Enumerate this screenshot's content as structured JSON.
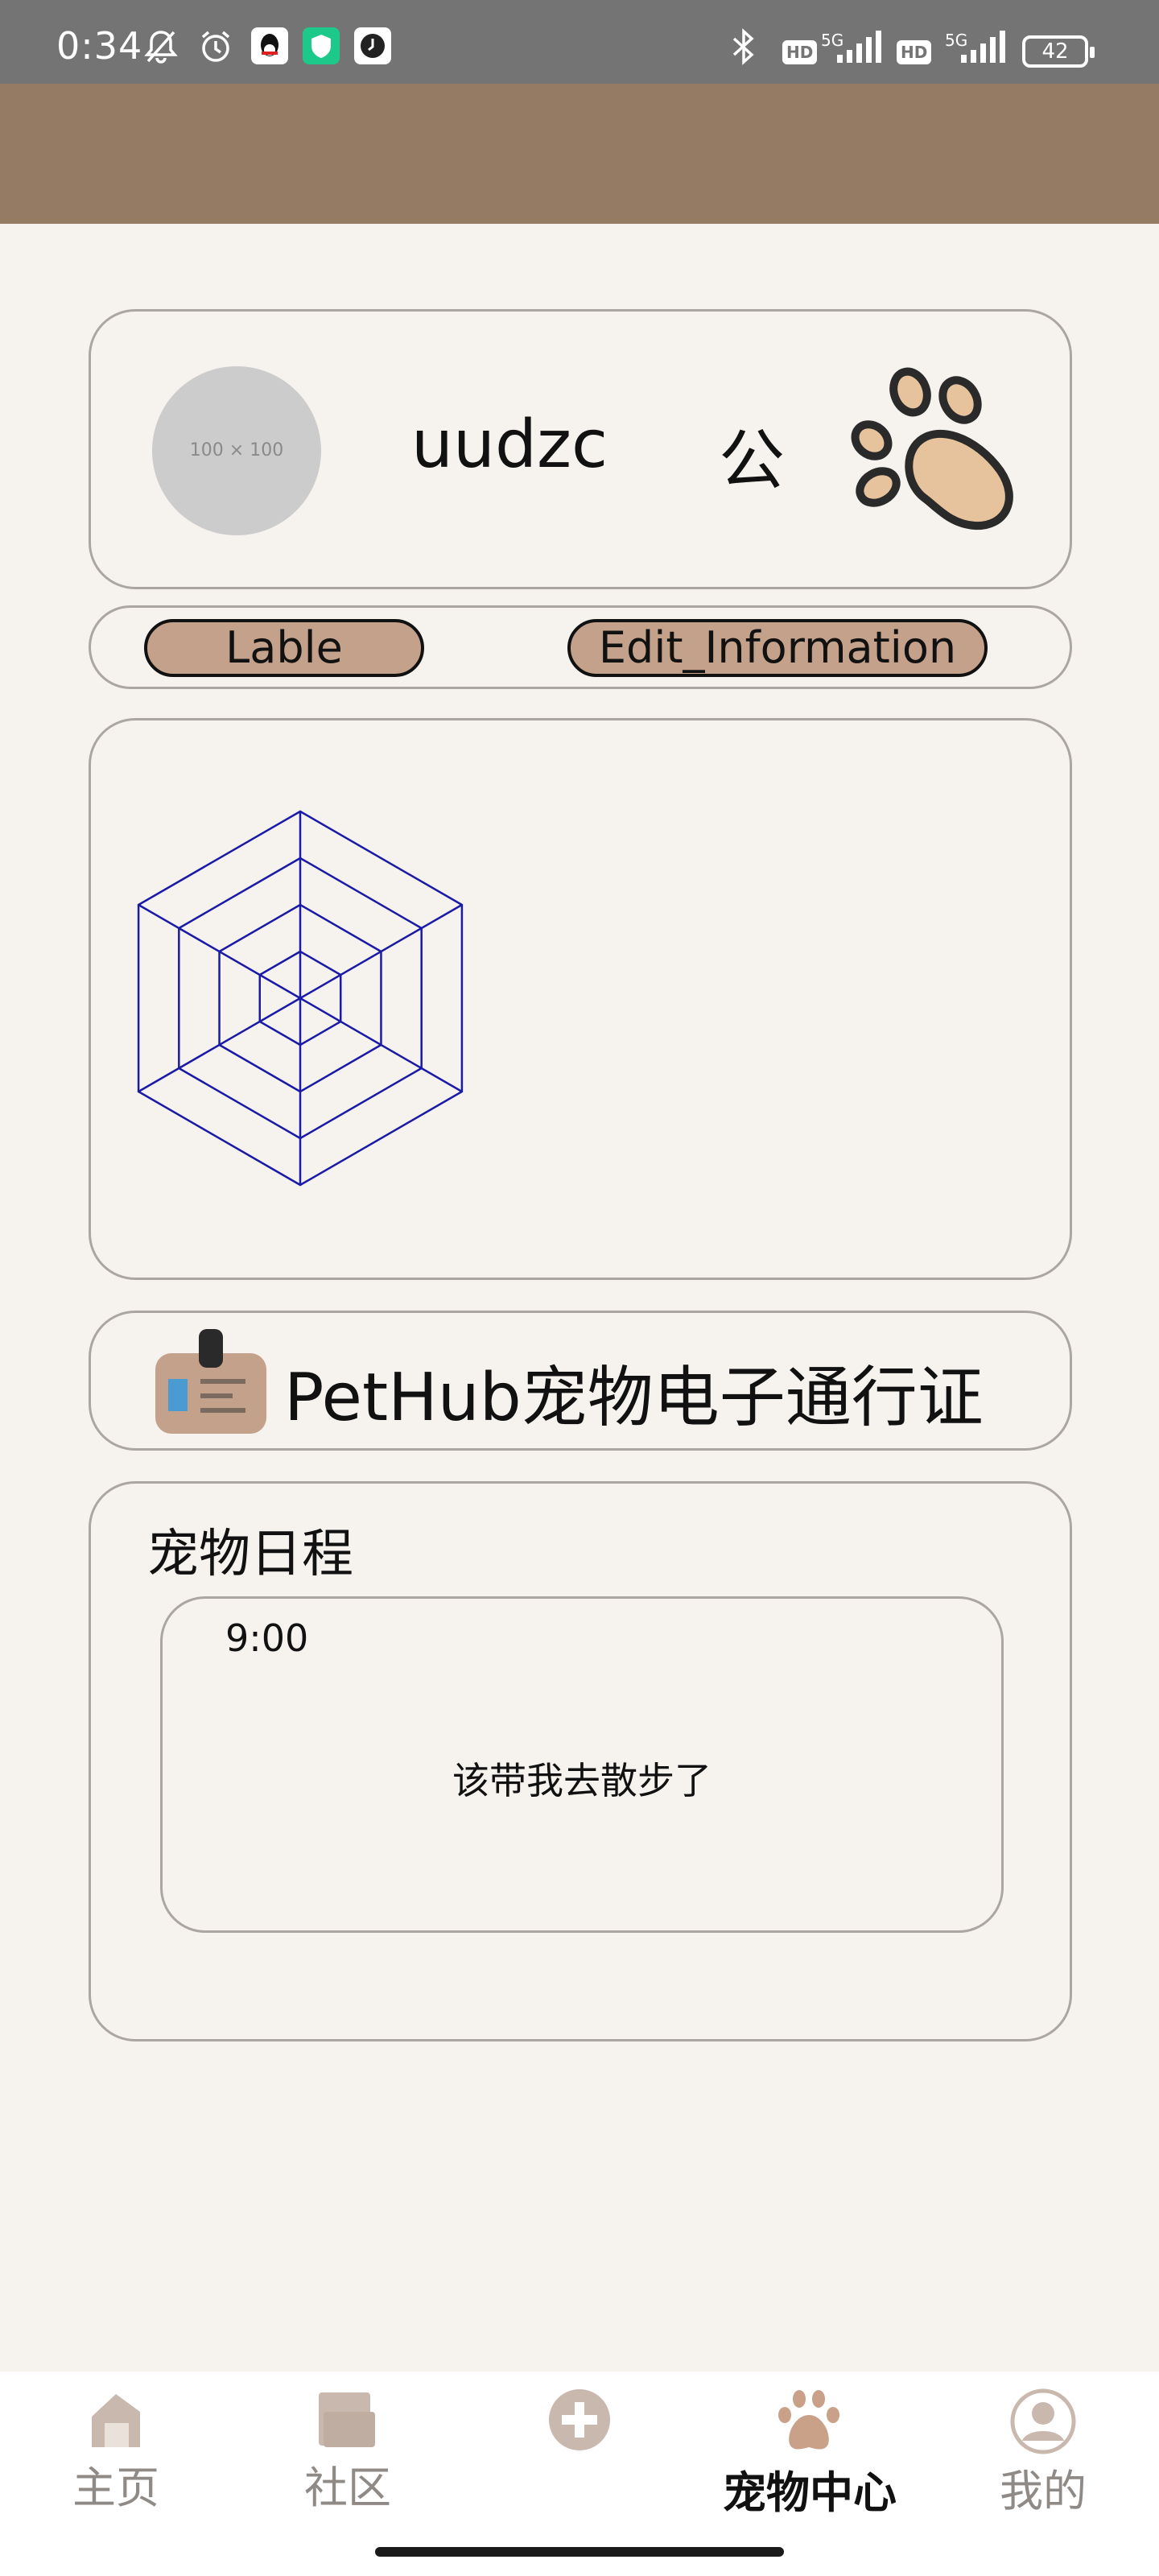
{
  "status_bar": {
    "time": "0:34",
    "battery": "42",
    "icons": [
      "mute-icon",
      "alarm-icon",
      "qq-icon",
      "security-app-icon",
      "clock-app-icon",
      "bluetooth-icon",
      "signal-icon"
    ],
    "network_badges": [
      "HD",
      "5G",
      "HD",
      "5G"
    ]
  },
  "profile": {
    "avatar_placeholder": "100 × 100",
    "name": "uudzc",
    "gender": "公",
    "logo_icon": "paw-icon"
  },
  "actions": {
    "label_button": "Lable",
    "edit_button": "Edit_Information"
  },
  "radar_chart": {
    "levels": 4,
    "axes": 6,
    "color": "#1A1AA6"
  },
  "pass": {
    "title": "PetHub宠物电子通行证",
    "icon": "id-badge-icon"
  },
  "schedule": {
    "title": "宠物日程",
    "items": [
      {
        "time": "9:00",
        "text": "该带我去散步了"
      }
    ]
  },
  "nav": {
    "items": [
      {
        "label": "主页",
        "icon": "home-icon",
        "active": false
      },
      {
        "label": "社区",
        "icon": "folder-icon",
        "active": false
      },
      {
        "label": "",
        "icon": "plus-circle-icon",
        "active": false
      },
      {
        "label": "宠物中心",
        "icon": "paw-icon",
        "active": true
      },
      {
        "label": "我的",
        "icon": "user-icon",
        "active": false
      }
    ]
  },
  "colors": {
    "header": "#957A64",
    "button_fill": "#C4A18A",
    "nav_icon": "#C9B8AE",
    "background": "#F6F3EF"
  }
}
